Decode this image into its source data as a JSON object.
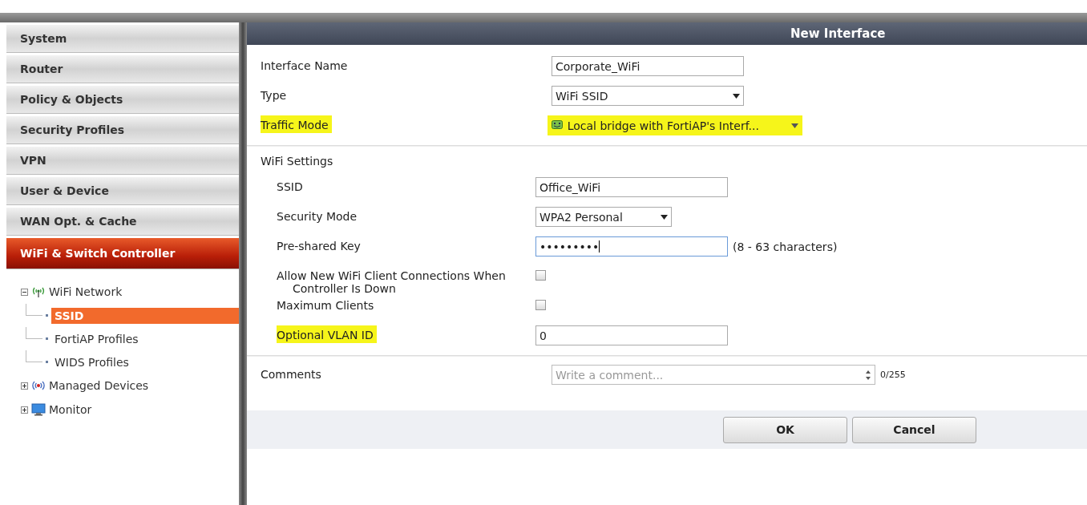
{
  "sidebar": {
    "menu": [
      {
        "label": "System",
        "selected": false
      },
      {
        "label": "Router",
        "selected": false
      },
      {
        "label": "Policy & Objects",
        "selected": false
      },
      {
        "label": "Security Profiles",
        "selected": false
      },
      {
        "label": "VPN",
        "selected": false
      },
      {
        "label": "User & Device",
        "selected": false
      },
      {
        "label": "WAN Opt. & Cache",
        "selected": false
      },
      {
        "label": "WiFi & Switch Controller",
        "selected": true
      }
    ],
    "tree": [
      {
        "label": "WiFi Network",
        "kind": "wifi",
        "expanded": true,
        "children": [
          {
            "label": "SSID",
            "selected": true
          },
          {
            "label": "FortiAP Profiles",
            "selected": false
          },
          {
            "label": "WIDS Profiles",
            "selected": false
          }
        ]
      },
      {
        "label": "Managed Devices",
        "kind": "devices",
        "expanded": false
      },
      {
        "label": "Monitor",
        "kind": "monitor",
        "expanded": false
      }
    ]
  },
  "dialog": {
    "title": "New Interface",
    "general": [
      {
        "kind": "text",
        "label": "Interface Name",
        "value": "Corporate_WiFi",
        "highlighted": false
      },
      {
        "kind": "select",
        "label": "Type",
        "value": "WiFi SSID",
        "highlighted": false
      },
      {
        "kind": "mode",
        "label": "Traffic Mode",
        "value": "Local bridge with FortiAP's Interf...",
        "highlighted": true
      }
    ],
    "wifi_settings": {
      "title": "WiFi Settings",
      "rows": [
        {
          "kind": "text",
          "label": "SSID",
          "value": "Office_WiFi",
          "highlighted": false
        },
        {
          "kind": "select",
          "label": "Security Mode",
          "value": "WPA2 Personal",
          "highlighted": false
        },
        {
          "kind": "password",
          "label": "Pre-shared Key",
          "value": "•••••••••",
          "hint": "(8 - 63 characters)",
          "highlighted": false
        },
        {
          "kind": "checkbox",
          "label": "Allow New WiFi Client Connections When",
          "label_2": "Controller Is Down",
          "checked": false,
          "highlighted": false
        },
        {
          "kind": "checkbox",
          "label": "Maximum Clients",
          "checked": false,
          "highlighted": false
        },
        {
          "kind": "text",
          "label": "Optional VLAN ID",
          "value": "0",
          "highlighted": true
        }
      ]
    },
    "comments": {
      "label": "Comments",
      "placeholder": "Write a comment...",
      "counter": "0/255"
    },
    "buttons": [
      "OK",
      "Cancel"
    ]
  }
}
